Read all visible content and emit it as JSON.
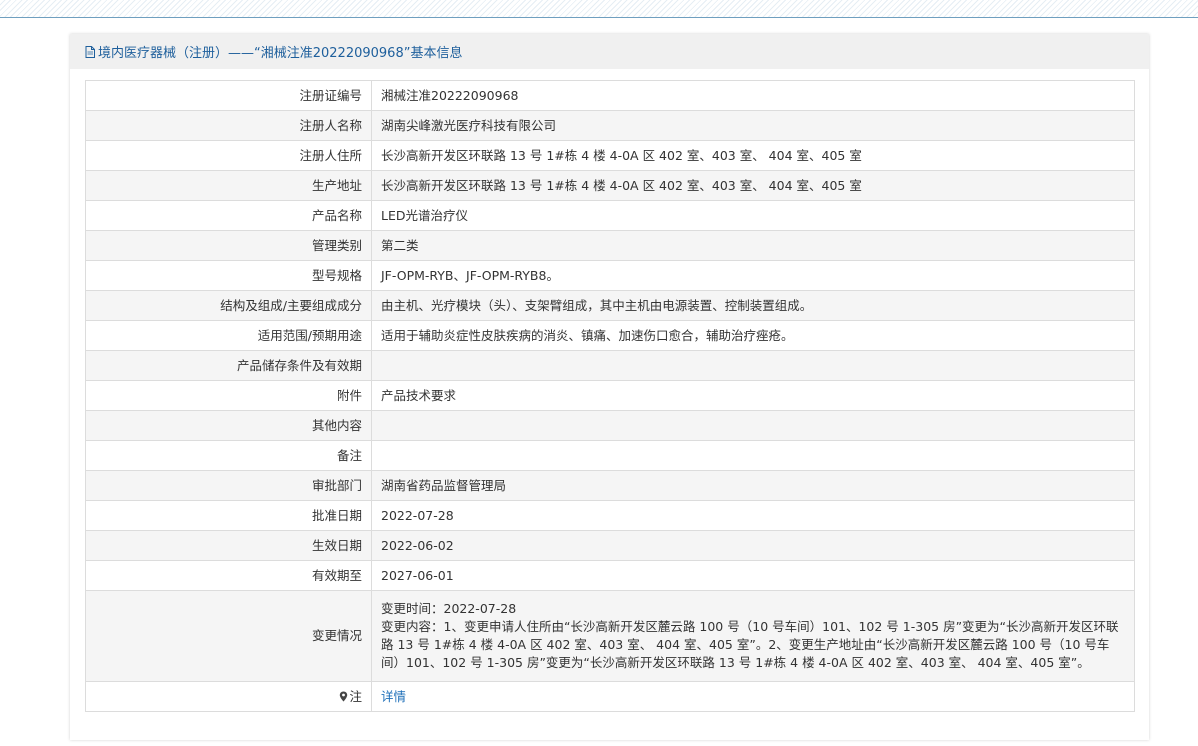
{
  "header": {
    "title": "境内医疗器械（注册）——“湘械注准20222090968”基本信息"
  },
  "rows": [
    {
      "label": "注册证编号",
      "value": "湘械注准20222090968"
    },
    {
      "label": "注册人名称",
      "value": "湖南尖峰激光医疗科技有限公司"
    },
    {
      "label": "注册人住所",
      "value": "长沙高新开发区环联路 13 号 1#栋 4 楼 4-0A 区 402 室、403 室、 404 室、405 室"
    },
    {
      "label": "生产地址",
      "value": "长沙高新开发区环联路 13 号 1#栋 4 楼 4-0A 区 402 室、403 室、 404 室、405 室"
    },
    {
      "label": "产品名称",
      "value": "LED光谱治疗仪"
    },
    {
      "label": "管理类别",
      "value": "第二类"
    },
    {
      "label": "型号规格",
      "value": "JF-OPM-RYB、JF-OPM-RYB8。"
    },
    {
      "label": "结构及组成/主要组成成分",
      "value": "由主机、光疗模块（头）、支架臂组成，其中主机由电源装置、控制装置组成。"
    },
    {
      "label": "适用范围/预期用途",
      "value": "适用于辅助炎症性皮肤疾病的消炎、镇痛、加速伤口愈合，辅助治疗痤疮。"
    },
    {
      "label": "产品储存条件及有效期",
      "value": ""
    },
    {
      "label": "附件",
      "value": "产品技术要求"
    },
    {
      "label": "其他内容",
      "value": ""
    },
    {
      "label": "备注",
      "value": ""
    },
    {
      "label": "审批部门",
      "value": "湖南省药品监督管理局"
    },
    {
      "label": "批准日期",
      "value": "2022-07-28"
    },
    {
      "label": "生效日期",
      "value": "2022-06-02"
    },
    {
      "label": "有效期至",
      "value": "2027-06-01"
    }
  ],
  "change": {
    "label": "变更情况",
    "time": "变更时间：2022-07-28",
    "content": "变更内容：1、变更申请人住所由“长沙高新开发区麓云路 100 号（10 号车间）101、102 号 1-305 房”变更为“长沙高新开发区环联路 13 号 1#栋 4 楼 4-0A 区 402 室、403 室、 404 室、405 室”。2、变更生产地址由“长沙高新开发区麓云路 100 号（10 号车间）101、102 号 1-305 房”变更为“长沙高新开发区环联路 13 号 1#栋 4 楼 4-0A 区 402 室、403 室、 404 室、405 室”。"
  },
  "note": {
    "label": "注",
    "link": "详情"
  }
}
